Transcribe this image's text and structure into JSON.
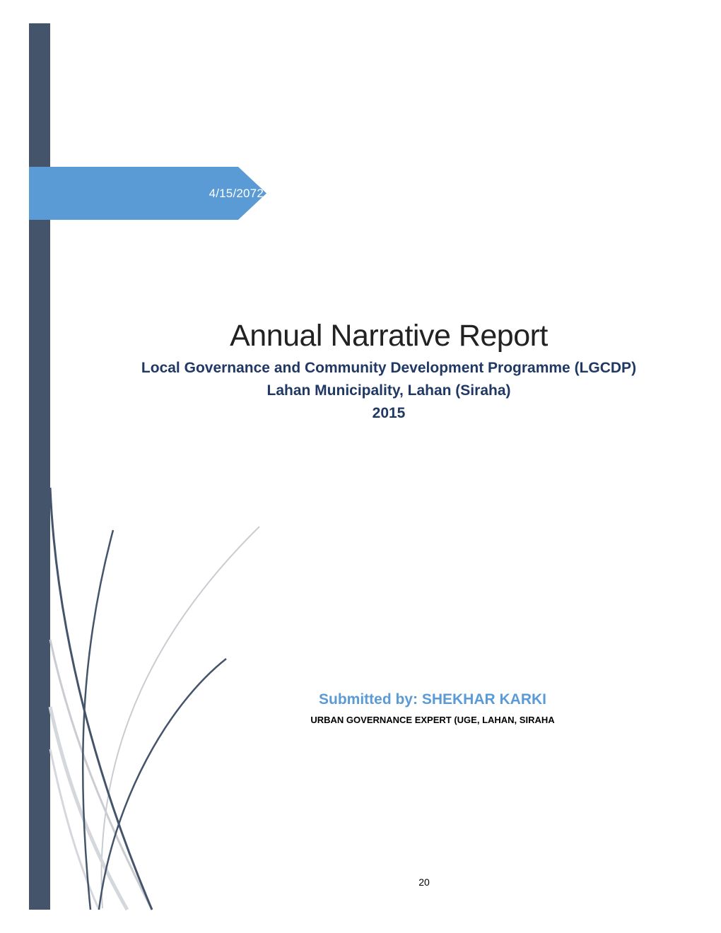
{
  "cover": {
    "date": "4/15/2072",
    "title": "Annual Narrative Report",
    "subtitle_1": "Local Governance and Community Development Programme (LGCDP)",
    "subtitle_2": "Lahan Municipality, Lahan (Siraha)",
    "year": "2015",
    "submitted_by": "Submitted by: SHEKHAR KARKI",
    "role": "URBAN GOVERNANCE EXPERT (UGE, LAHAN, SIRAHA",
    "page_number": "20"
  },
  "colors": {
    "sidebar": "#44546a",
    "banner": "#5b9bd5",
    "subtitle": "#1f3864",
    "submitted": "#5b9bd5"
  }
}
